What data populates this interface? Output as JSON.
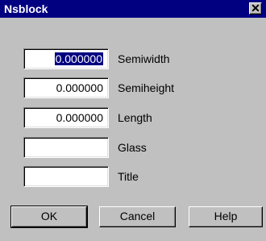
{
  "window": {
    "title": "Nsblock",
    "close_glyph": "✕"
  },
  "fields": [
    {
      "value": "0.000000",
      "label": "Semiwidth",
      "selected": true
    },
    {
      "value": "0.000000",
      "label": "Semiheight"
    },
    {
      "value": "0.000000",
      "label": "Length"
    },
    {
      "value": "",
      "label": "Glass"
    },
    {
      "value": "",
      "label": "Title"
    }
  ],
  "buttons": {
    "ok": "OK",
    "cancel": "Cancel",
    "help": "Help"
  },
  "colors": {
    "titlebar": "#000080",
    "face": "#c0c0c0",
    "selection": "#000080"
  }
}
